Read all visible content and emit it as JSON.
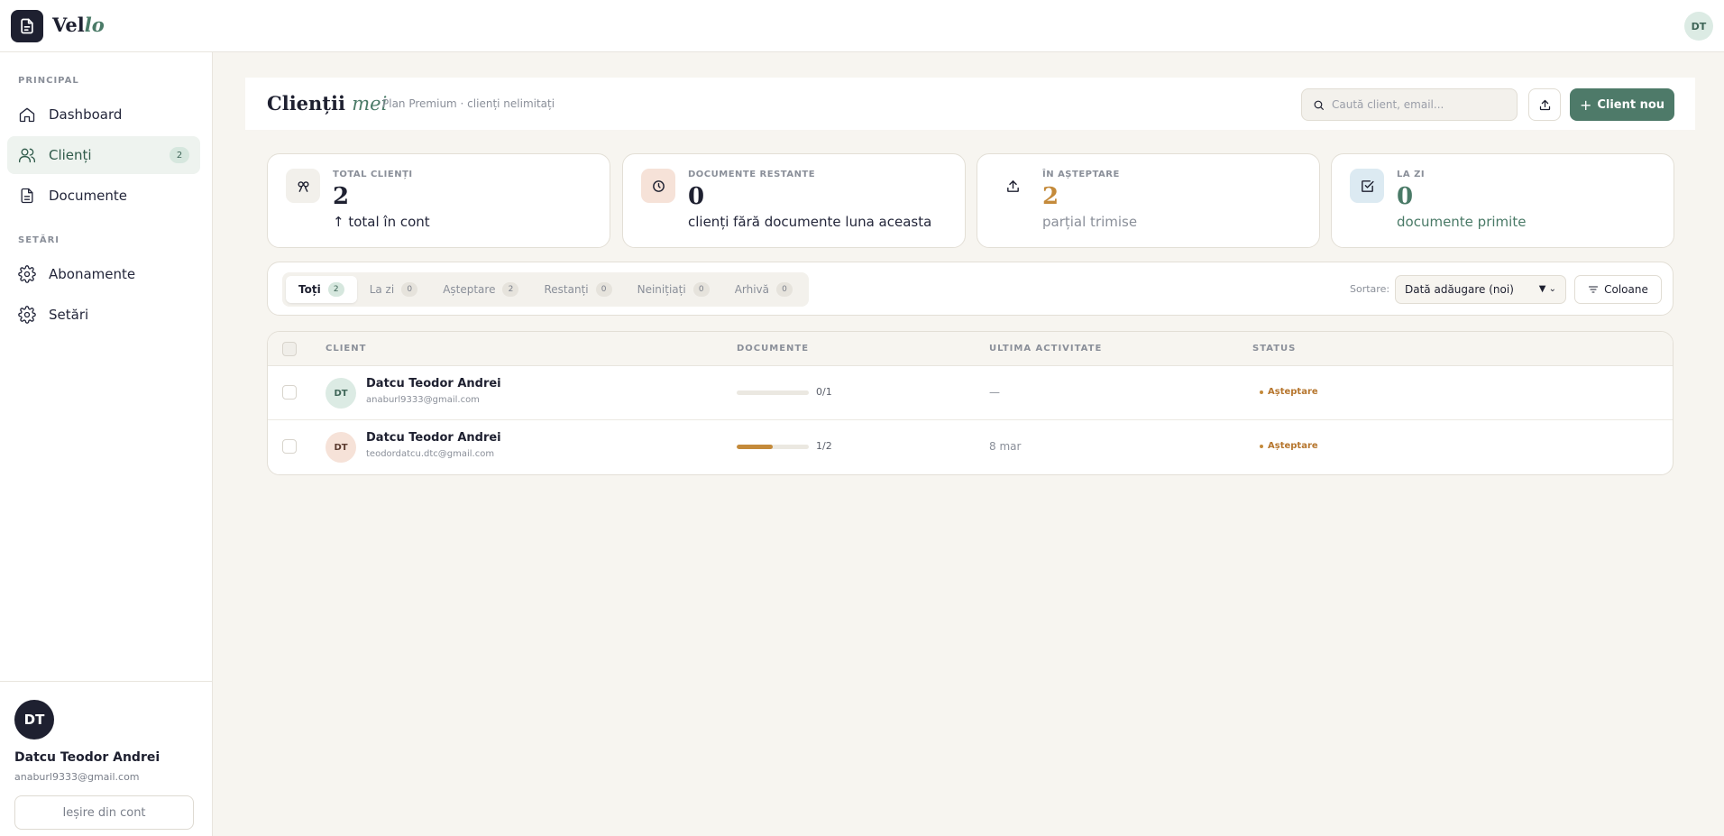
{
  "app": {
    "logo_main": "Vel",
    "logo_accent": "lo",
    "user_initials": "DT"
  },
  "sidebar": {
    "section_principal": "PRINCIPAL",
    "section_settings": "SETĂRI",
    "items": [
      {
        "label": "Dashboard",
        "icon": "home-icon"
      },
      {
        "label": "Clienți",
        "icon": "users-icon",
        "badge": "2"
      },
      {
        "label": "Documente",
        "icon": "document-icon"
      },
      {
        "label": "Abonamente",
        "icon": "gear-icon"
      },
      {
        "label": "Setări",
        "icon": "gear-icon"
      }
    ],
    "user": {
      "initials": "DT",
      "name": "Datcu Teodor Andrei",
      "email": "anaburl9333@gmail.com"
    },
    "logout_label": "Ieșire din cont"
  },
  "header": {
    "title_main": "Clienții",
    "title_accent": "mei",
    "plan_text": "Plan Premium · clienți nelimitați",
    "search_placeholder": "Caută client, email...",
    "new_client_label": "Client nou"
  },
  "stats": [
    {
      "label": "TOTAL CLIENȚI",
      "value": "2",
      "sub": "↑ total în cont",
      "icon": "clients-icon",
      "icon_bg": "#f2f0eb",
      "value_color": "#1e2030",
      "sub_color": "#23263a"
    },
    {
      "label": "DOCUMENTE RESTANTE",
      "value": "0",
      "sub": "clienți fără documente luna aceasta",
      "icon": "clock-icon",
      "icon_bg": "#f6e2d8",
      "value_color": "#1e2030",
      "sub_color": "#23263a"
    },
    {
      "label": "ÎN AȘTEPTARE",
      "value": "2",
      "sub": "parțial trimise",
      "icon": "upload-icon",
      "icon_bg": "#ffffff",
      "value_color": "#c48a3a",
      "sub_color": "#8a8f99"
    },
    {
      "label": "LA ZI",
      "value": "0",
      "sub": "documente primite",
      "icon": "check-square-icon",
      "icon_bg": "#dceaf2",
      "value_color": "#4a7a67",
      "sub_color": "#4a7a67"
    }
  ],
  "filters": {
    "tabs": [
      {
        "label": "Toți",
        "count": "2"
      },
      {
        "label": "La zi",
        "count": "0"
      },
      {
        "label": "Așteptare",
        "count": "2"
      },
      {
        "label": "Restanți",
        "count": "0"
      },
      {
        "label": "Neinițiați",
        "count": "0"
      },
      {
        "label": "Arhivă",
        "count": "0"
      }
    ],
    "sort_label": "Sortare:",
    "sort_value": "Dată adăugare (noi)",
    "columns_label": "Coloane"
  },
  "table": {
    "headers": {
      "client": "CLIENT",
      "documents": "DOCUMENTE",
      "last_activity": "ULTIMA ACTIVITATE",
      "status": "STATUS"
    },
    "rows": [
      {
        "initials": "DT",
        "avatar_bg": "#dcebe4",
        "avatar_color": "#3e6557",
        "name": "Datcu Teodor Andrei",
        "email": "anaburl9333@gmail.com",
        "progress_fraction": 0,
        "documents": "0/1",
        "last_activity": "—",
        "status": "Așteptare"
      },
      {
        "initials": "DT",
        "avatar_bg": "#f6e2d8",
        "avatar_color": "#5a3a2e",
        "name": "Datcu Teodor Andrei",
        "email": "teodordatcu.dtc@gmail.com",
        "progress_fraction": 0.5,
        "documents": "1/2",
        "last_activity": "8 mar",
        "status": "Așteptare"
      }
    ]
  },
  "colors": {
    "accent": "#4e7a69",
    "warning": "#c48a3a",
    "dark": "#1e2030"
  }
}
